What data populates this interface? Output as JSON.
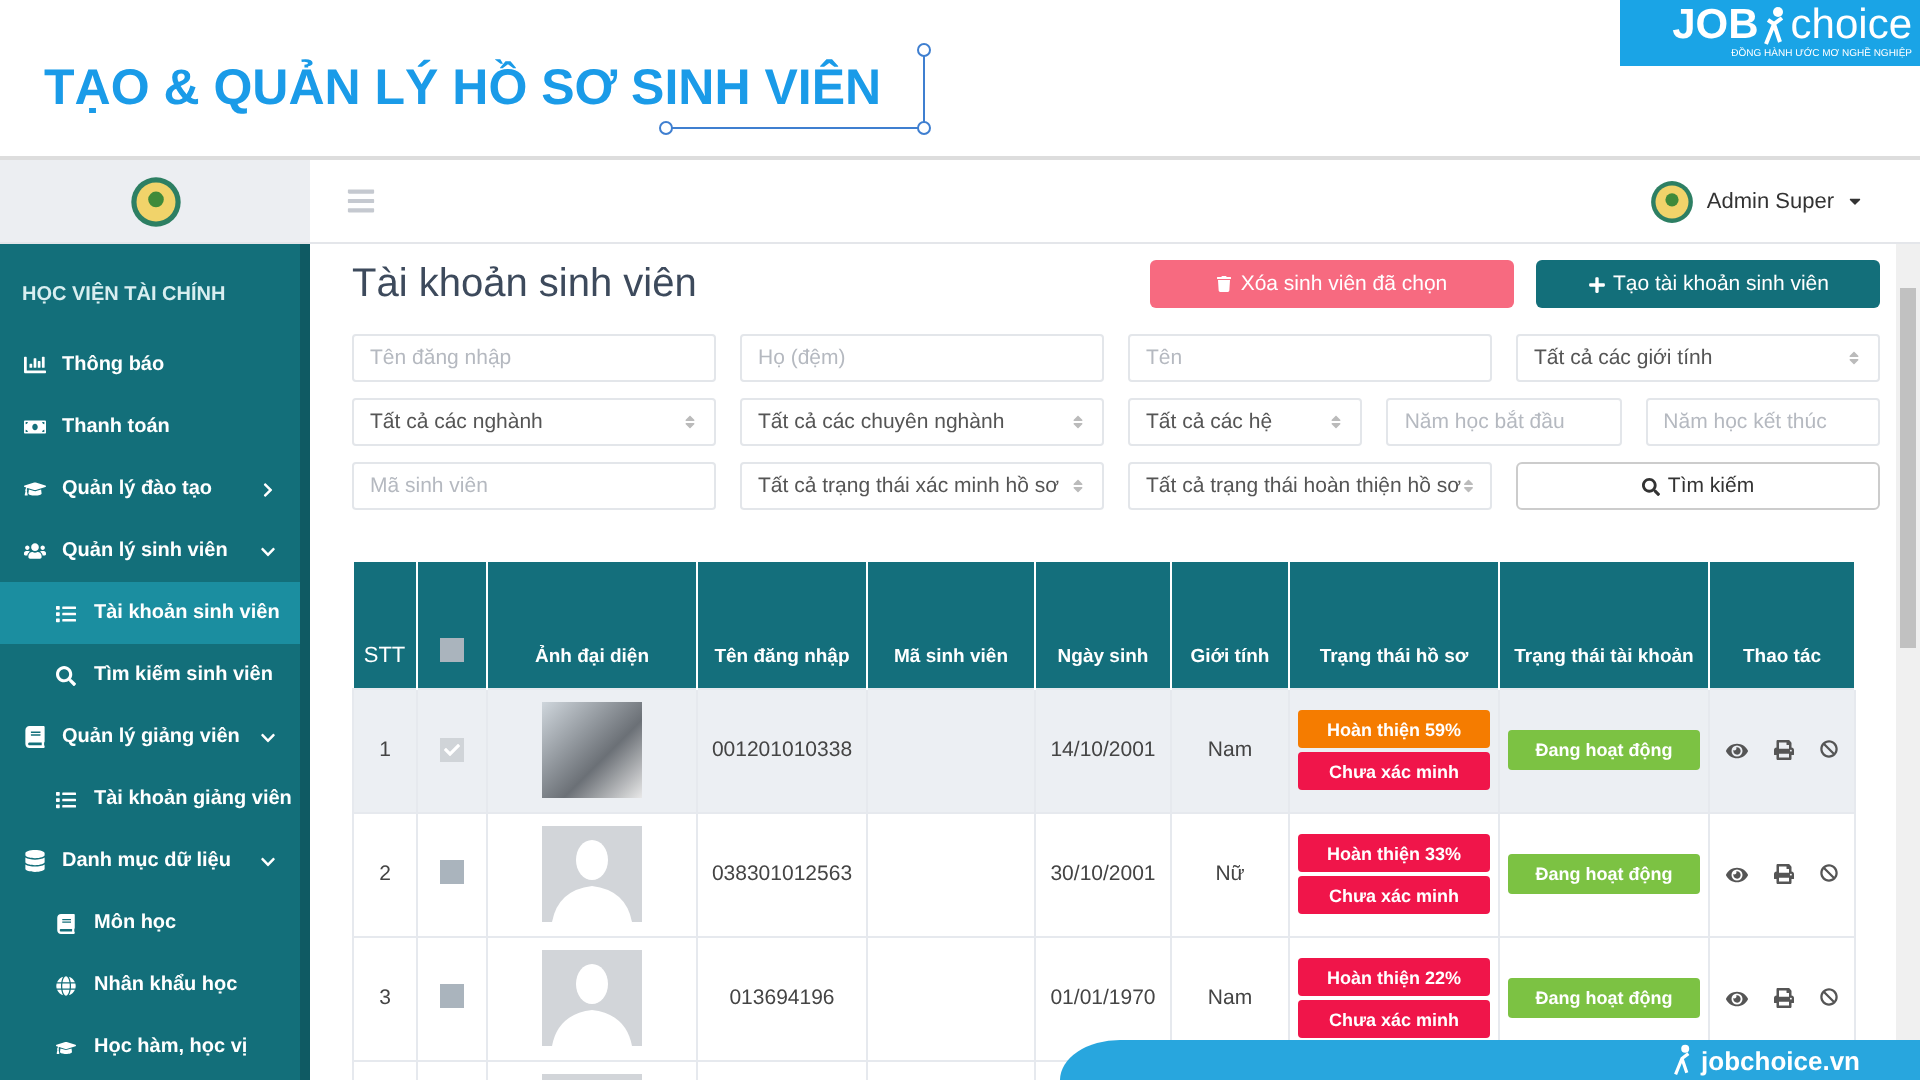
{
  "slide": {
    "title": "TẠO & QUẢN LÝ HỒ SƠ SINH VIÊN",
    "brand": {
      "word_1": "JOB",
      "word_2": "choice",
      "tagline": "ĐỒNG HÀNH ƯỚC MƠ NGHỀ NGHIỆP"
    },
    "footer_link": "jobchoice.vn"
  },
  "topbar": {
    "user": "Admin Super"
  },
  "sidebar": {
    "heading": "HỌC VIỆN TÀI CHÍNH",
    "items": [
      {
        "label": "Thông báo",
        "selected": false
      },
      {
        "label": "Thanh toán",
        "selected": false
      },
      {
        "label": "Quản lý đào tạo",
        "selected": false,
        "expanded": false
      },
      {
        "label": "Quản lý sinh viên",
        "selected": false,
        "expanded": true,
        "children": [
          {
            "label": "Tài khoản sinh viên",
            "selected": true
          },
          {
            "label": "Tìm kiếm sinh viên",
            "selected": false
          }
        ]
      },
      {
        "label": "Quản lý giảng viên",
        "selected": false,
        "expanded": true,
        "children": [
          {
            "label": "Tài khoản giảng viên",
            "selected": false
          }
        ]
      },
      {
        "label": "Danh mục dữ liệu",
        "selected": false,
        "expanded": true,
        "children": [
          {
            "label": "Môn học",
            "selected": false
          },
          {
            "label": "Nhân khẩu học",
            "selected": false
          },
          {
            "label": "Học hàm, học vị",
            "selected": false
          }
        ]
      }
    ]
  },
  "page": {
    "title": "Tài khoản sinh viên",
    "buttons": [
      {
        "kind": "danger",
        "label": "Xóa sinh viên đã chọn"
      },
      {
        "kind": "primary",
        "label": "Tạo tài khoản sinh viên"
      }
    ]
  },
  "filters": [
    [
      {
        "kind": "input",
        "placeholder": "Tên đăng nhập"
      },
      {
        "kind": "input",
        "placeholder": "Họ (đệm)"
      },
      {
        "kind": "input",
        "placeholder": "Tên"
      },
      {
        "kind": "select",
        "value": "Tất cả các giới tính"
      }
    ],
    [
      {
        "kind": "select",
        "value": "Tất cả các nghành"
      },
      {
        "kind": "select",
        "value": "Tất cả các chuyên nghành"
      },
      {
        "kind": "select",
        "value": "Tất cả các hệ"
      },
      {
        "kind": "input",
        "placeholder": "Năm học bắt đầu"
      },
      {
        "kind": "input",
        "placeholder": "Năm học kết thúc"
      }
    ],
    [
      {
        "kind": "input",
        "placeholder": "Mã sinh viên"
      },
      {
        "kind": "select",
        "value": "Tất cả trạng thái xác minh hồ sơ"
      },
      {
        "kind": "select",
        "value": "Tất cả trạng thái hoàn thiện hồ sơ"
      },
      {
        "kind": "button",
        "label": "Tìm kiếm"
      }
    ]
  ],
  "table": {
    "columns": [
      "STT",
      "Ảnh đại diện",
      "Tên đăng nhập",
      "Mã sinh viên",
      "Ngày sinh",
      "Giới tính",
      "Trạng thái hồ sơ",
      "Trạng thái tài khoản",
      "Thao tác"
    ],
    "select_all_checked": false,
    "rows": [
      {
        "stt": "1",
        "selected": true,
        "checked": true,
        "avatar": {
          "kind": "photo"
        },
        "username": "001201010338",
        "dob": "14/10/2001",
        "gender": "Nam",
        "completion": {
          "text": "Hoàn thiện 59%",
          "color": "#f57c00"
        },
        "verification": "Chưa xác minh",
        "account_status": "Đang hoạt động"
      },
      {
        "stt": "2",
        "selected": false,
        "checked": false,
        "avatar": {
          "kind": "placeholder"
        },
        "username": "038301012563",
        "dob": "30/10/2001",
        "gender": "Nữ",
        "completion": {
          "text": "Hoàn thiện 33%",
          "color": "#f0154a"
        },
        "verification": "Chưa xác minh",
        "account_status": "Đang hoạt động"
      },
      {
        "stt": "3",
        "selected": false,
        "checked": false,
        "avatar": {
          "kind": "placeholder"
        },
        "username": "013694196",
        "dob": "01/01/1970",
        "gender": "Nam",
        "completion": {
          "text": "Hoàn thiện 22%",
          "color": "#f0154a"
        },
        "verification": "Chưa xác minh",
        "account_status": "Đang hoạt động"
      },
      {
        "avatar": {
          "kind": "placeholder"
        }
      }
    ]
  }
}
